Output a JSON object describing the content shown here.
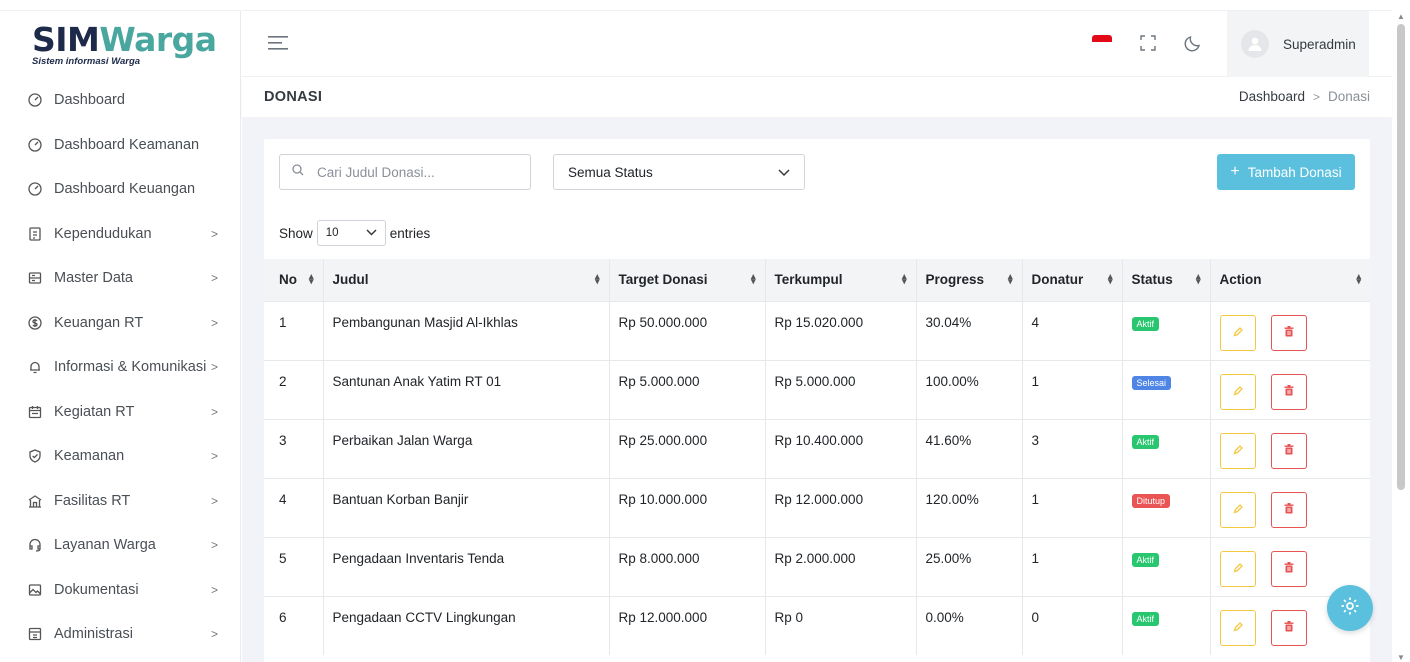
{
  "brand": {
    "part1": "SIM",
    "part2": "Warga",
    "subtitle": "Sistem informasi Warga"
  },
  "sidebar": {
    "items": [
      {
        "label": "Dashboard",
        "icon": "dashboard-icon",
        "has_children": false
      },
      {
        "label": "Dashboard Keamanan",
        "icon": "dashboard-icon",
        "has_children": false
      },
      {
        "label": "Dashboard Keuangan",
        "icon": "dashboard-icon",
        "has_children": false
      },
      {
        "label": "Kependudukan",
        "icon": "id-card-icon",
        "has_children": true
      },
      {
        "label": "Master Data",
        "icon": "database-icon",
        "has_children": true
      },
      {
        "label": "Keuangan RT",
        "icon": "dollar-circle-icon",
        "has_children": true
      },
      {
        "label": "Informasi & Komunikasi",
        "icon": "bell-icon",
        "has_children": true
      },
      {
        "label": "Kegiatan RT",
        "icon": "calendar-icon",
        "has_children": true
      },
      {
        "label": "Keamanan",
        "icon": "shield-check-icon",
        "has_children": true
      },
      {
        "label": "Fasilitas RT",
        "icon": "building-icon",
        "has_children": true
      },
      {
        "label": "Layanan Warga",
        "icon": "support-icon",
        "has_children": true
      },
      {
        "label": "Dokumentasi",
        "icon": "image-icon",
        "has_children": true
      },
      {
        "label": "Administrasi",
        "icon": "archive-icon",
        "has_children": true
      }
    ],
    "chevron": ">"
  },
  "topbar": {
    "username": "Superadmin"
  },
  "page": {
    "title": "DONASI",
    "breadcrumb": [
      "Dashboard",
      "Donasi"
    ],
    "breadcrumb_sep": ">"
  },
  "filters": {
    "search_placeholder": "Cari Judul Donasi...",
    "status_selected": "Semua Status",
    "add_button": "Tambah Donasi",
    "show_label": "Show",
    "entries_value": "10",
    "entries_label": "entries"
  },
  "table": {
    "columns": [
      "No",
      "Judul",
      "Target Donasi",
      "Terkumpul",
      "Progress",
      "Donatur",
      "Status",
      "Action"
    ],
    "rows": [
      {
        "no": "1",
        "judul": "Pembangunan Masjid Al-Ikhlas",
        "target": "Rp 50.000.000",
        "terkumpul": "Rp 15.020.000",
        "progress": "30.04%",
        "donatur": "4",
        "status": "Aktif",
        "status_type": "aktif"
      },
      {
        "no": "2",
        "judul": "Santunan Anak Yatim RT 01",
        "target": "Rp 5.000.000",
        "terkumpul": "Rp 5.000.000",
        "progress": "100.00%",
        "donatur": "1",
        "status": "Selesai",
        "status_type": "selesai"
      },
      {
        "no": "3",
        "judul": "Perbaikan Jalan Warga",
        "target": "Rp 25.000.000",
        "terkumpul": "Rp 10.400.000",
        "progress": "41.60%",
        "donatur": "3",
        "status": "Aktif",
        "status_type": "aktif"
      },
      {
        "no": "4",
        "judul": "Bantuan Korban Banjir",
        "target": "Rp 10.000.000",
        "terkumpul": "Rp 12.000.000",
        "progress": "120.00%",
        "donatur": "1",
        "status": "Ditutup",
        "status_type": "ditutup"
      },
      {
        "no": "5",
        "judul": "Pengadaan Inventaris Tenda",
        "target": "Rp 8.000.000",
        "terkumpul": "Rp 2.000.000",
        "progress": "25.00%",
        "donatur": "1",
        "status": "Aktif",
        "status_type": "aktif"
      },
      {
        "no": "6",
        "judul": "Pengadaan CCTV Lingkungan",
        "target": "Rp 12.000.000",
        "terkumpul": "Rp 0",
        "progress": "0.00%",
        "donatur": "0",
        "status": "Aktif",
        "status_type": "aktif"
      }
    ]
  },
  "colors": {
    "accent": "#5bc0de",
    "aktif": "#28c76f",
    "selesai": "#4f86e6",
    "ditutup": "#ea5455",
    "edit": "#f5c842",
    "delete": "#e55353"
  }
}
